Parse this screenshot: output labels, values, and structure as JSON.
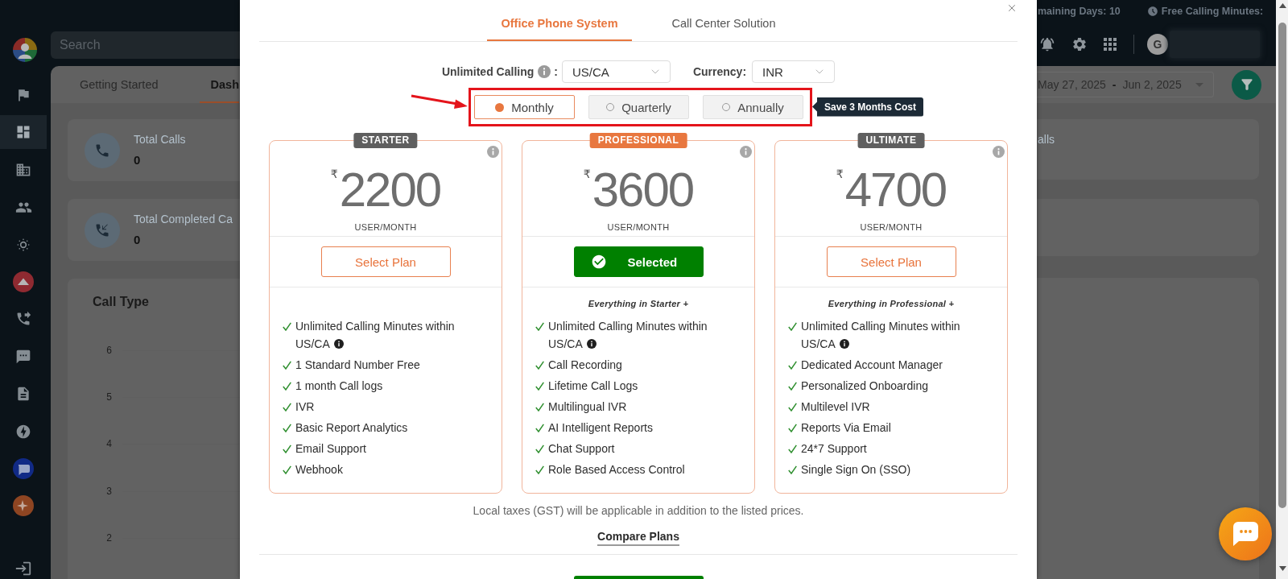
{
  "sidebar": {
    "items": [
      {
        "selected": false
      },
      {
        "selected": true
      },
      {
        "selected": false
      },
      {
        "selected": false
      },
      {
        "selected": false
      },
      {
        "selected": false
      },
      {
        "selected": false
      },
      {
        "selected": false
      },
      {
        "selected": false
      },
      {
        "selected": false
      },
      {
        "selected": false
      },
      {
        "selected": false
      }
    ]
  },
  "top_bar": {
    "search": {
      "placeholder": "Search"
    },
    "remaining_days": "maining Days: 10",
    "free_minutes": "Free Calling Minutes:",
    "avatar_initial": "G"
  },
  "dashboard": {
    "tabs": [
      {
        "label": "Getting Started",
        "selected": false
      },
      {
        "label": "Dash",
        "selected": true
      }
    ],
    "date_range": {
      "start": "May 27, 2025",
      "separator": "-",
      "end": "Jun 2, 2025"
    },
    "stat_cards": [
      {
        "label": "Total Calls",
        "value": "0"
      },
      {
        "label": "Total Completed Ca",
        "value": "0"
      }
    ],
    "right_stat_label": "alls",
    "call_type": {
      "title": "Call Type",
      "y_ticks": [
        "6",
        "5",
        "4",
        "3",
        "2"
      ]
    }
  },
  "modal": {
    "tabs": [
      {
        "label": "Office Phone System",
        "selected": true
      },
      {
        "label": "Call Center Solution",
        "selected": false
      }
    ],
    "calling_region": {
      "label": "Unlimited Calling",
      "separator": ":",
      "value": "US/CA"
    },
    "currency": {
      "label": "Currency:",
      "value": "INR"
    },
    "billing_periods": [
      {
        "label": "Monthly",
        "selected": true
      },
      {
        "label": "Quarterly",
        "selected": false
      },
      {
        "label": "Annually",
        "selected": false
      }
    ],
    "tooltip": "Save 3 Months Cost",
    "plans": [
      {
        "badge": "STARTER",
        "color": "#5f5f5f",
        "currency_symbol": "₹",
        "price": "2200",
        "period": "USER/MONTH",
        "button": "Select Plan",
        "selected": false,
        "features": [
          {
            "text": "Unlimited Calling Minutes within US/CA",
            "info": true
          },
          {
            "text": "1 Standard Number Free",
            "info": false
          },
          {
            "text": "1 month Call logs",
            "info": false
          },
          {
            "text": "IVR",
            "info": false
          },
          {
            "text": "Basic Report Analytics",
            "info": false
          },
          {
            "text": "Email Support",
            "info": false
          },
          {
            "text": "Webhook",
            "info": false
          }
        ]
      },
      {
        "badge": "PROFESSIONAL",
        "color": "#e8773f",
        "currency_symbol": "₹",
        "price": "3600",
        "period": "USER/MONTH",
        "button": "Selected",
        "selected": true,
        "intro": "Everything in Starter +",
        "features": [
          {
            "text": "Unlimited Calling Minutes within US/CA",
            "info": true
          },
          {
            "text": "Call Recording",
            "info": false
          },
          {
            "text": "Lifetime Call Logs",
            "info": false
          },
          {
            "text": "Multilingual IVR",
            "info": false
          },
          {
            "text": "AI Intelligent Reports",
            "info": false
          },
          {
            "text": "Chat Support",
            "info": false
          },
          {
            "text": "Role Based Access Control",
            "info": false
          }
        ]
      },
      {
        "badge": "ULTIMATE",
        "color": "#5f5f5f",
        "currency_symbol": "₹",
        "price": "4700",
        "period": "USER/MONTH",
        "button": "Select Plan",
        "selected": false,
        "intro": "Everything in Professional +",
        "features": [
          {
            "text": "Unlimited Calling Minutes within US/CA",
            "info": true
          },
          {
            "text": "Dedicated Account Manager",
            "info": false
          },
          {
            "text": "Personalized Onboarding",
            "info": false
          },
          {
            "text": "Multilevel IVR",
            "info": false
          },
          {
            "text": "Reports Via Email",
            "info": false
          },
          {
            "text": "24*7 Support",
            "info": false
          },
          {
            "text": "Single Sign On (SSO)",
            "info": false
          }
        ]
      }
    ],
    "tax_note": "Local taxes (GST) will be applicable in addition to the listed prices.",
    "compare_link": "Compare Plans"
  }
}
